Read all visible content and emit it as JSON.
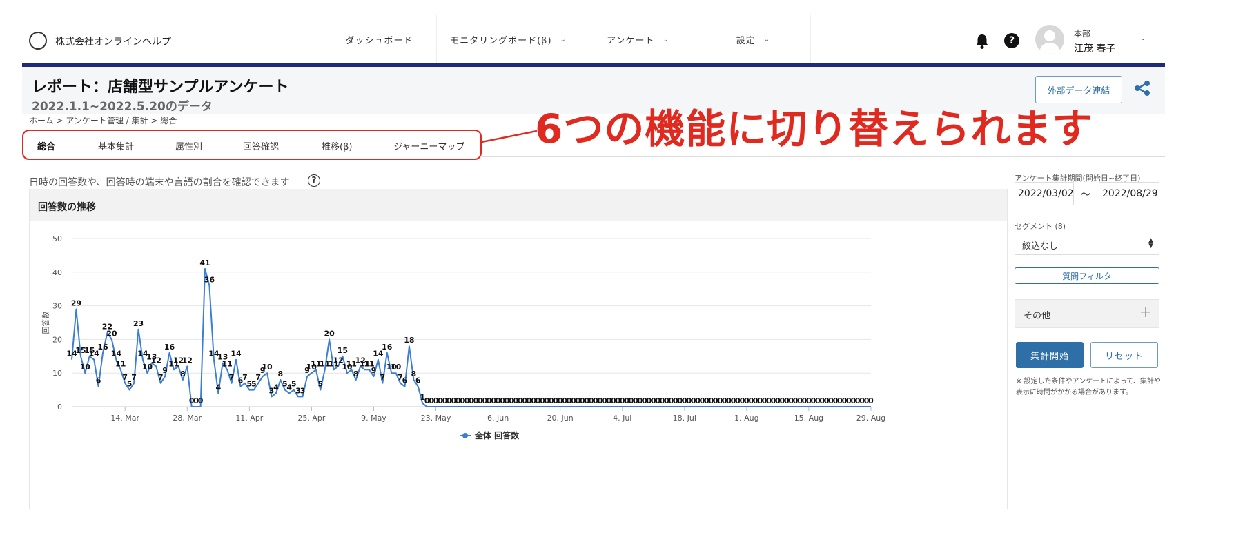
{
  "header": {
    "company": "株式会社オンラインヘルプ",
    "nav": [
      {
        "label": "ダッシュボード",
        "chevron": false
      },
      {
        "label": "モニタリングボード(β)",
        "chevron": true
      },
      {
        "label": "アンケート",
        "chevron": true
      },
      {
        "label": "設定",
        "chevron": true
      }
    ],
    "user_dept": "本部",
    "user_name": "江茂 春子",
    "help_glyph": "?"
  },
  "page": {
    "title": "レポート：店舗型サンプルアンケート",
    "subtitle": "2022.1.1~2022.5.20のデータ",
    "breadcrumb": "ホーム > アンケート管理 / 集計 > 総合",
    "external_button": "外部データ連結"
  },
  "tabs": [
    "総合",
    "基本集計",
    "属性別",
    "回答確認",
    "推移(β)",
    "ジャーニーマップ"
  ],
  "active_tab": "総合",
  "callout": "6つの機能に切り替えられます",
  "callout_color": "#e02a20",
  "description": "日時の回答数や、回答時の端末や言語の割合を確認できます",
  "panel_title": "回答数の推移",
  "chart_data": {
    "type": "line",
    "title": "",
    "ylabel": "回答数",
    "ylim": [
      0,
      50
    ],
    "yticks": [
      0,
      10,
      20,
      30,
      40,
      50
    ],
    "x_start": "2022-03-02",
    "x_end": "2022-08-29",
    "xtick_labels": [
      "14. Mar",
      "28. Mar",
      "11. Apr",
      "25. Apr",
      "9. May",
      "23. May",
      "6. Jun",
      "20. Jun",
      "4. Jul",
      "18. Jul",
      "1. Aug",
      "15. Aug",
      "29. Aug"
    ],
    "xtick_dates": [
      "2022-03-14",
      "2022-03-28",
      "2022-04-11",
      "2022-04-25",
      "2022-05-09",
      "2022-05-23",
      "2022-06-06",
      "2022-06-20",
      "2022-07-04",
      "2022-07-18",
      "2022-08-01",
      "2022-08-15",
      "2022-08-29"
    ],
    "series": [
      {
        "name": "全体 回答数",
        "color": "#3a7fd5",
        "values": [
          14,
          29,
          15,
          10,
          15,
          14,
          6,
          16,
          22,
          20,
          14,
          11,
          7,
          5,
          7,
          23,
          14,
          10,
          13,
          12,
          7,
          9,
          16,
          11,
          12,
          8,
          12,
          0,
          0,
          0,
          41,
          36,
          14,
          4,
          13,
          11,
          7,
          14,
          6,
          7,
          5,
          5,
          7,
          9,
          10,
          3,
          4,
          8,
          5,
          4,
          5,
          3,
          3,
          9,
          10,
          11,
          5,
          11,
          20,
          11,
          12,
          15,
          10,
          11,
          8,
          12,
          11,
          11,
          9,
          14,
          7,
          16,
          10,
          10,
          7,
          6,
          18,
          8,
          6,
          1,
          0,
          0,
          0,
          0,
          0,
          0,
          0,
          0,
          0,
          0,
          0,
          0,
          0,
          0,
          0,
          0,
          0,
          0,
          0,
          0,
          0,
          0,
          0,
          0,
          0,
          0,
          0,
          0,
          0,
          0,
          0,
          0,
          0,
          0,
          0,
          0,
          0,
          0,
          0,
          0,
          0,
          0,
          0,
          0,
          0,
          0,
          0,
          0,
          0,
          0,
          0,
          0,
          0,
          0,
          0,
          0,
          0,
          0,
          0,
          0,
          0,
          0,
          0,
          0,
          0,
          0,
          0,
          0,
          0,
          0,
          0,
          0,
          0,
          0,
          0,
          0,
          0,
          0,
          0,
          0,
          0,
          0,
          0,
          0,
          0,
          0,
          0,
          0,
          0,
          0,
          0,
          0,
          0,
          0,
          0,
          0,
          0,
          0,
          0,
          0,
          0
        ]
      }
    ],
    "legend": "bottom-center",
    "grid": true
  },
  "sidebar": {
    "period_label": "アンケート集計期間(開始日~終了日)",
    "start_date": "2022/03/02",
    "tilde": "〜",
    "end_date": "2022/08/29",
    "segment_label": "セグメント (8)",
    "segment_value": "絞込なし",
    "filter_button": "質問フィルタ",
    "other_label": "その他",
    "start_button": "集計開始",
    "reset_button": "リセット",
    "note": "※ 設定した条件やアンケートによって、集計や表示に時間がかかる場合があります。"
  },
  "accent_color": "#2f6fa8",
  "nav_bar_color": "#1d2a7a"
}
